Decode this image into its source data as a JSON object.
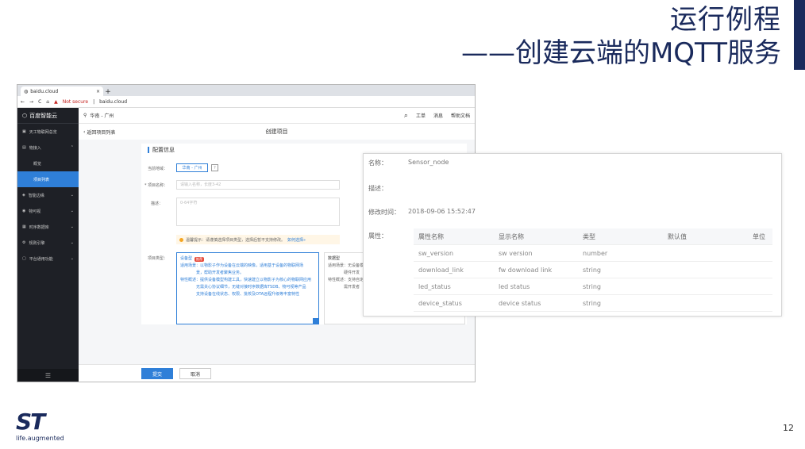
{
  "slide": {
    "title_line1": "运行例程",
    "title_line2": "——创建云端的MQTT服务",
    "page_number": "12",
    "logo_tagline": "life.augmented"
  },
  "browser": {
    "tab_title": "baidu.cloud",
    "tab_close": "×",
    "tab_add": "+",
    "not_secure": "Not secure",
    "url": "baidu.cloud"
  },
  "sidebar": {
    "brand": "百度智能云",
    "items": [
      {
        "label": "天工物联网总览"
      },
      {
        "label": "物接入"
      },
      {
        "label": "概览"
      },
      {
        "label": "项目列表"
      },
      {
        "label": "智能边缘"
      },
      {
        "label": "物可视"
      },
      {
        "label": "时序数据库"
      },
      {
        "label": "规则引擎"
      },
      {
        "label": "平台通用功能"
      }
    ]
  },
  "topnav": {
    "region": "华南 - 广州",
    "links": [
      "工单",
      "消息",
      "帮助文档"
    ]
  },
  "crumb": {
    "back": "返回项目列表",
    "page_title": "创建项目"
  },
  "form": {
    "section": "配置信息",
    "region_label": "当前地域：",
    "region_value": "华南 - 广州",
    "name_label": "* 项目名称：",
    "name_placeholder": "请输入名称，长度3-42",
    "desc_label": "描述：",
    "desc_placeholder": "0-64字符",
    "notice": "温馨提示：请谨慎选择项目类型，选择后暂不支持修改。",
    "notice_link": "如何选择»",
    "type_label": "项目类型：",
    "type_device": {
      "title": "设备型",
      "badge": "推荐",
      "line1": "适用场景：以物影子作为设备在云端的映像，适用基于设备的物联网场",
      "line2": "景，帮助开发者聚焦业务。",
      "line3": "特性概述：提供设备模型构建工具，快速建立以物影子为核心的物联网应用",
      "line4": "无需关心协议细节，无缝对接时序数据库TSDB、物可视等产品",
      "line5": "支持设备在线状态、权限、批校及OTA远程升级等丰富特性"
    },
    "type_data": {
      "title": "数据型",
      "line1": "适用场景：无设备模",
      "line2": "硬件开发",
      "line3": "特性概述：支持自定",
      "line4": "需开发者"
    },
    "submit": "提交",
    "cancel": "取消"
  },
  "detail": {
    "name_label": "名称：",
    "name_value": "Sensor_node",
    "desc_label": "描述：",
    "modified_label": "修改时间：",
    "modified_value": "2018-09-06 15:52:47",
    "attr_label": "属性：",
    "columns": [
      "属性名称",
      "显示名称",
      "类型",
      "默认值",
      "单位"
    ],
    "rows": [
      [
        "sw_version",
        "sw version",
        "number",
        "",
        ""
      ],
      [
        "download_link",
        "fw download link",
        "string",
        "",
        ""
      ],
      [
        "led_status",
        "led status",
        "string",
        "",
        ""
      ],
      [
        "device_status",
        "device status",
        "string",
        "",
        ""
      ]
    ]
  }
}
